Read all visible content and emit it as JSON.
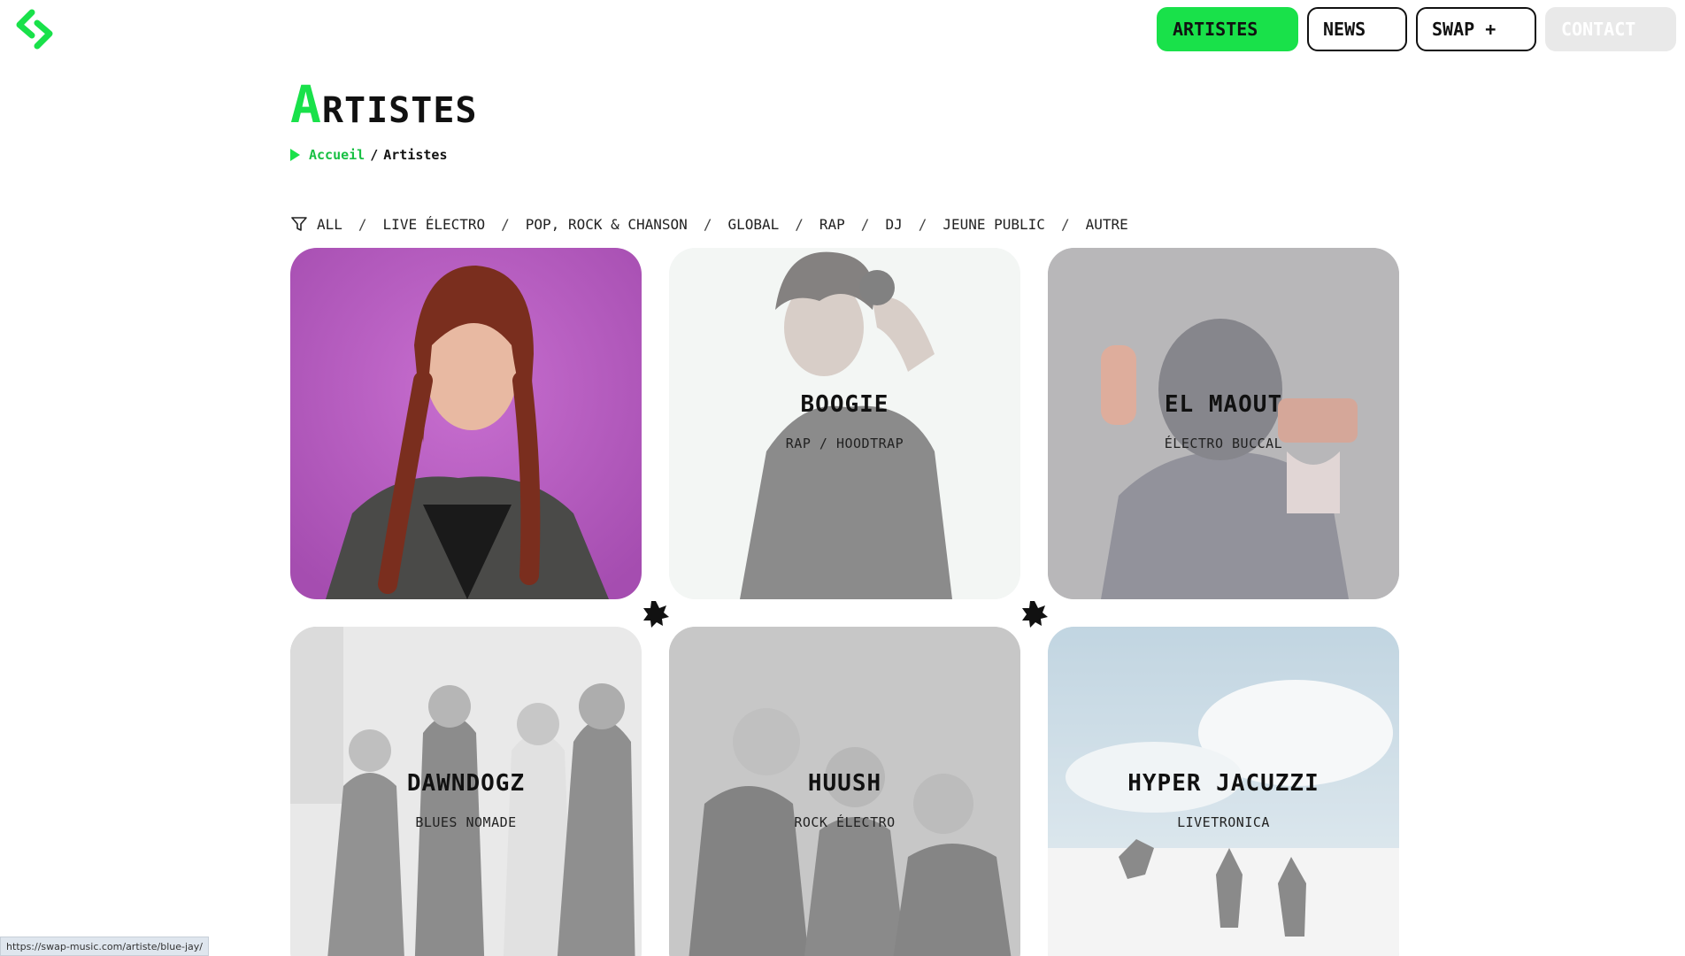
{
  "header": {
    "logo_icon": "swap-logo-icon",
    "nav": [
      {
        "id": "artistes",
        "label": "ARTISTES"
      },
      {
        "id": "news",
        "label": "NEWS"
      },
      {
        "id": "swap",
        "label": "SWAP +"
      },
      {
        "id": "contact",
        "label": "CONTACT"
      }
    ]
  },
  "page": {
    "title_first": "A",
    "title_rest": "RTISTES",
    "breadcrumb": {
      "home": "Accueil",
      "separator": "/",
      "current": "Artistes"
    }
  },
  "filters": {
    "icon": "filter-icon",
    "separator": "/",
    "items": [
      "ALL",
      "LIVE ÉLECTRO",
      "POP, ROCK & CHANSON",
      "GLOBAL",
      "RAP",
      "DJ",
      "JEUNE PUBLIC",
      "AUTRE"
    ]
  },
  "artists": [
    {
      "name": "",
      "genre": ""
    },
    {
      "name": "BOOGIE",
      "genre": "RAP / HOODTRAP"
    },
    {
      "name": "EL MAOUT",
      "genre": "ÉLECTRO BUCCAL"
    },
    {
      "name": "DAWNDOGZ",
      "genre": "BLUES NOMADE"
    },
    {
      "name": "HUUSH",
      "genre": "ROCK ÉLECTRO"
    },
    {
      "name": "HYPER JACUZZI",
      "genre": "LIVETRONICA"
    }
  ],
  "status_bar": {
    "url": "https://swap-music.com/artiste/blue-jay/"
  },
  "colors": {
    "accent": "#19e14a",
    "text": "#111111"
  }
}
